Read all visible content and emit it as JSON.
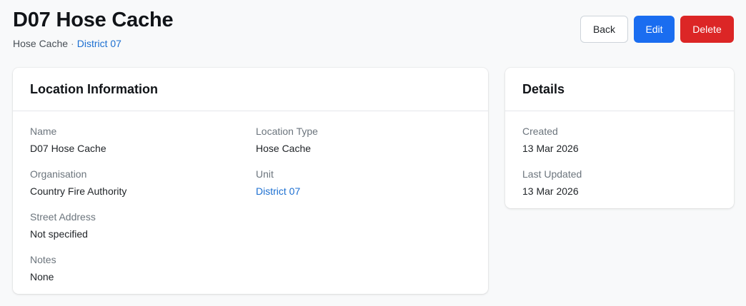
{
  "header": {
    "title": "D07 Hose Cache",
    "subtitle_type": "Hose Cache",
    "subtitle_separator": "·",
    "subtitle_link": "District 07"
  },
  "actions": {
    "back_label": "Back",
    "edit_label": "Edit",
    "delete_label": "Delete"
  },
  "location_info": {
    "heading": "Location Information",
    "fields": [
      {
        "label": "Name",
        "value": "D07 Hose Cache"
      },
      {
        "label": "Location Type",
        "value": "Hose Cache"
      },
      {
        "label": "Organisation",
        "value": "Country Fire Authority"
      },
      {
        "label": "Unit",
        "value": "District 07"
      },
      {
        "label": "Street Address",
        "value": "Not specified"
      },
      {
        "label": "Notes",
        "value": "None"
      }
    ]
  },
  "details": {
    "heading": "Details",
    "fields": [
      {
        "label": "Created",
        "value": "13 Mar 2026"
      },
      {
        "label": "Last Updated",
        "value": "13 Mar 2026"
      }
    ]
  },
  "colors": {
    "primary": "#1a6df0",
    "danger": "#dc2626",
    "link": "#1c6fd1"
  }
}
